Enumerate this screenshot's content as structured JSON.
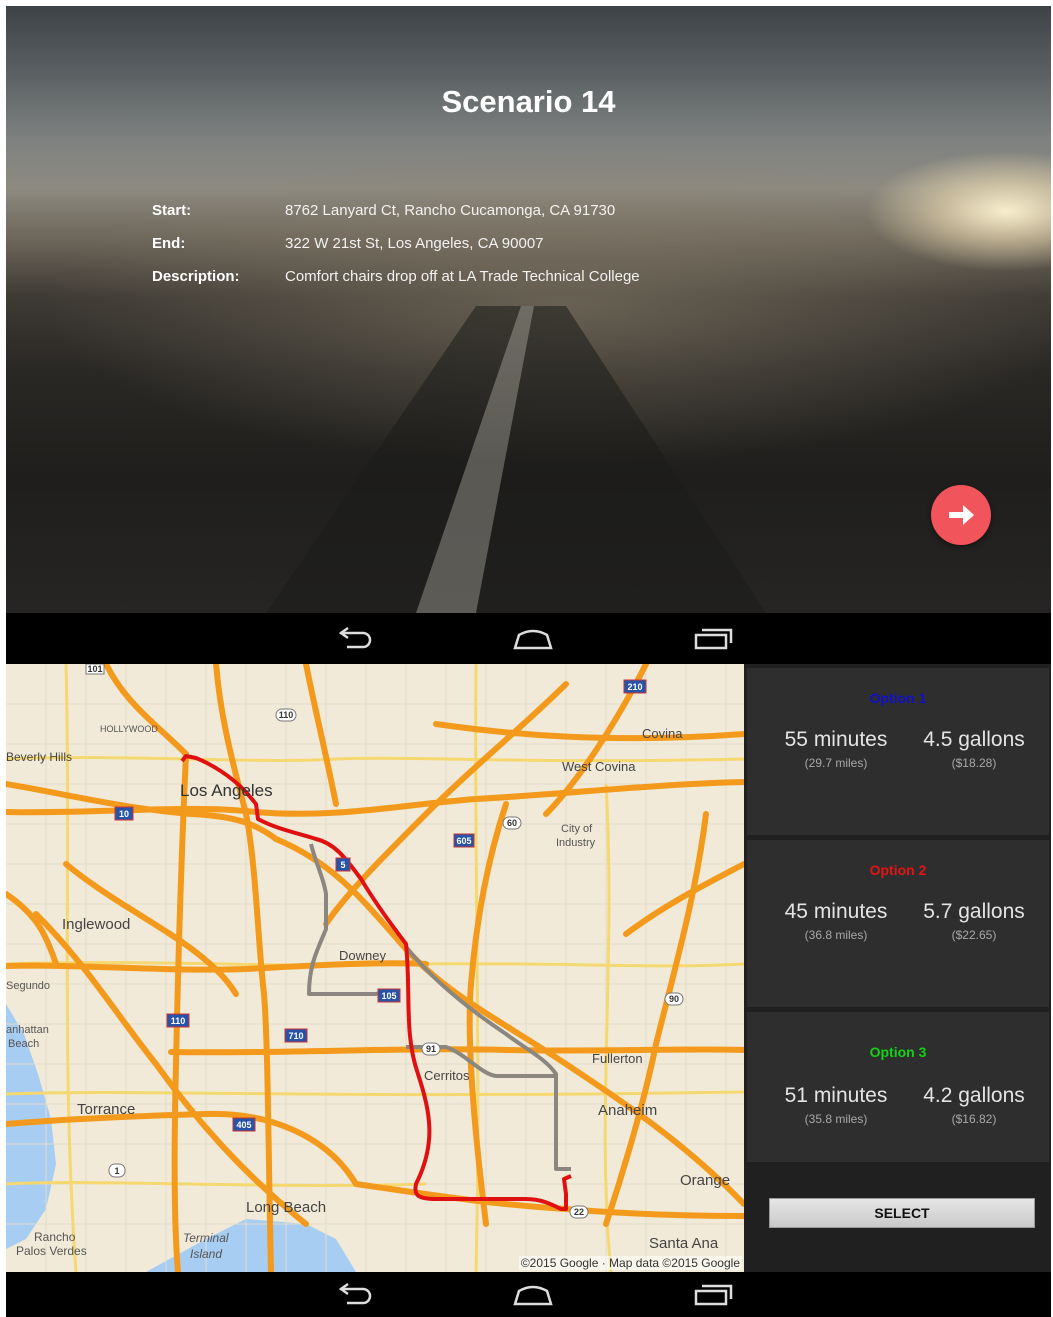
{
  "scenario": {
    "title": "Scenario 14",
    "start_label": "Start:",
    "start_value": "8762 Lanyard Ct, Rancho Cucamonga, CA 91730",
    "end_label": "End:",
    "end_value": "322 W 21st St, Los Angeles, CA 90007",
    "description_label": "Description:",
    "description_value": "Comfort chairs drop off at LA Trade Technical College",
    "next_icon": "arrow-right-icon",
    "accent_color": "#f2545b"
  },
  "nav_bar": {
    "icons": [
      "back-icon",
      "home-icon",
      "recent-apps-icon"
    ]
  },
  "map": {
    "places": {
      "beverly_hills": "Beverly Hills",
      "hollywood": "HOLLYWOOD",
      "los_angeles": "Los Angeles",
      "covina": "Covina",
      "west_covina": "West Covina",
      "city_of_industry_1": "City of",
      "city_of_industry_2": "Industry",
      "inglewood": "Inglewood",
      "downey": "Downey",
      "segundo": "Segundo",
      "manhattan_beach_1": "anhattan",
      "manhattan_beach_2": "Beach",
      "fullerton": "Fullerton",
      "cerritos": "Cerritos",
      "torrance": "Torrance",
      "anaheim": "Anaheim",
      "orange": "Orange",
      "long_beach": "Long Beach",
      "rancho_palos_verdes_1": "Rancho",
      "rancho_palos_verdes_2": "Palos Verdes",
      "terminal_island_1": "Terminal",
      "terminal_island_2": "Island",
      "santa_ana": "Santa Ana"
    },
    "shields": [
      "101",
      "110",
      "210",
      "10",
      "60",
      "605",
      "5",
      "105",
      "90",
      "110",
      "710",
      "91",
      "405",
      "1",
      "22"
    ],
    "attribution": "©2015 Google · Map data ©2015 Google",
    "route_colors": {
      "option_2": "#e01010",
      "alternate": "#8b8680"
    }
  },
  "options": [
    {
      "title": "Option 1",
      "color": "#1010cc",
      "minutes": "55 minutes",
      "miles": "(29.7 miles)",
      "gallons": "4.5 gallons",
      "cost": "($18.28)"
    },
    {
      "title": "Option 2",
      "color": "#e01515",
      "minutes": "45 minutes",
      "miles": "(36.8 miles)",
      "gallons": "5.7 gallons",
      "cost": "($22.65)"
    },
    {
      "title": "Option 3",
      "color": "#15d015",
      "minutes": "51 minutes",
      "miles": "(35.8 miles)",
      "gallons": "4.2 gallons",
      "cost": "($16.82)"
    }
  ],
  "select_label": "SELECT"
}
